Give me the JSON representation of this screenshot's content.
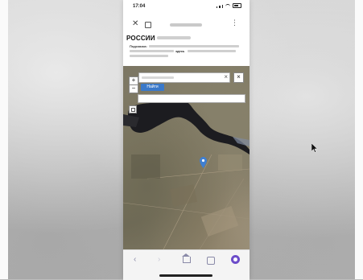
{
  "status_bar": {
    "time": "17:04"
  },
  "page": {
    "title": "РОССИИ",
    "hint_label": "Подсказка:",
    "hint_link": "здесь"
  },
  "map": {
    "search_button_label": "Найти",
    "zoom_in_label": "+",
    "zoom_out_label": "−",
    "clear_label": "×",
    "close_label": "×"
  },
  "colors": {
    "search_button": "#3b79c9",
    "profile_badge": "#6c4cc9",
    "marker": "#3f7fd1"
  },
  "icons": [
    "close-icon",
    "tabs-icon",
    "more-icon",
    "map-pin-icon",
    "layers-icon",
    "back-arrow-icon",
    "forward-arrow-icon",
    "home-icon",
    "tabs-icon",
    "profile-icon",
    "mouse-cursor-icon"
  ]
}
